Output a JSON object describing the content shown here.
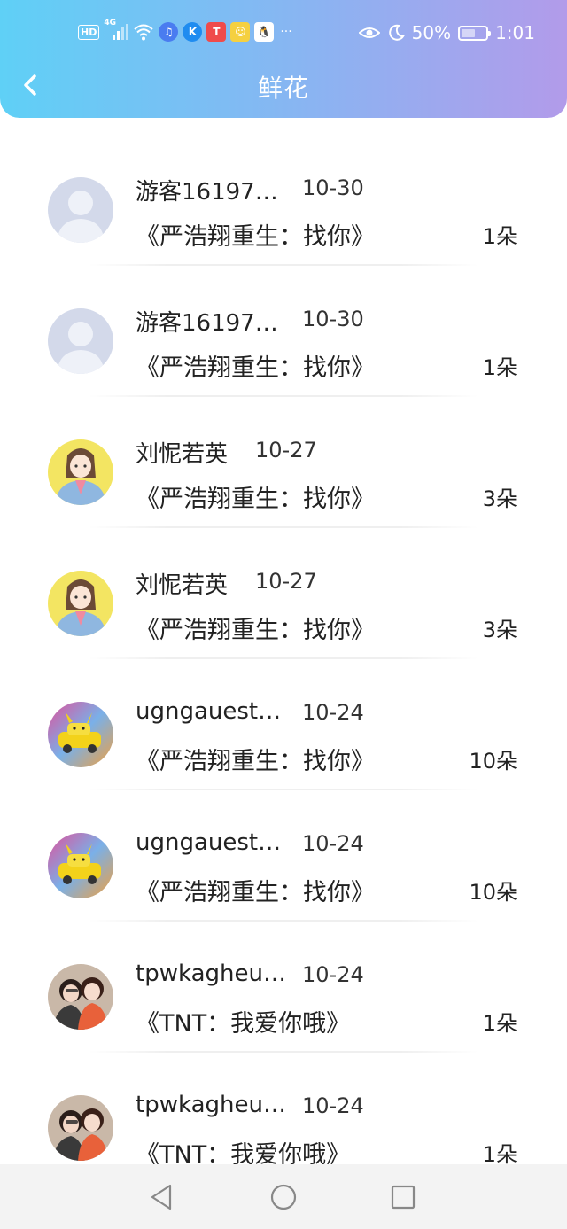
{
  "status_bar": {
    "network": "HD",
    "signal": "4G",
    "battery_percent": "50%",
    "time": "1:01",
    "more": "···"
  },
  "header": {
    "title": "鲜花"
  },
  "records": [
    {
      "name": "游客16197…",
      "date": "10-30",
      "work": "《严浩翔重生：找你》",
      "count": "1朵",
      "avatar": "default"
    },
    {
      "name": "游客16197…",
      "date": "10-30",
      "work": "《严浩翔重生：找你》",
      "count": "1朵",
      "avatar": "default"
    },
    {
      "name": "刘怩若英",
      "date": "10-27",
      "work": "《严浩翔重生：找你》",
      "count": "3朵",
      "avatar": "anime-girl"
    },
    {
      "name": "刘怩若英",
      "date": "10-27",
      "work": "《严浩翔重生：找你》",
      "count": "3朵",
      "avatar": "anime-girl"
    },
    {
      "name": "ugngauest…",
      "date": "10-24",
      "work": "《严浩翔重生：找你》",
      "count": "10朵",
      "avatar": "pikachu-car"
    },
    {
      "name": "ugngauest…",
      "date": "10-24",
      "work": "《严浩翔重生：找你》",
      "count": "10朵",
      "avatar": "pikachu-car"
    },
    {
      "name": "tpwkagheu…",
      "date": "10-24",
      "work": "《TNT：我爱你哦》",
      "count": "1朵",
      "avatar": "two-girls"
    },
    {
      "name": "tpwkagheu…",
      "date": "10-24",
      "work": "《TNT：我爱你哦》",
      "count": "1朵",
      "avatar": "two-girls"
    }
  ],
  "colors": {
    "header_start": "#5fd0f6",
    "header_end": "#b29bea"
  }
}
